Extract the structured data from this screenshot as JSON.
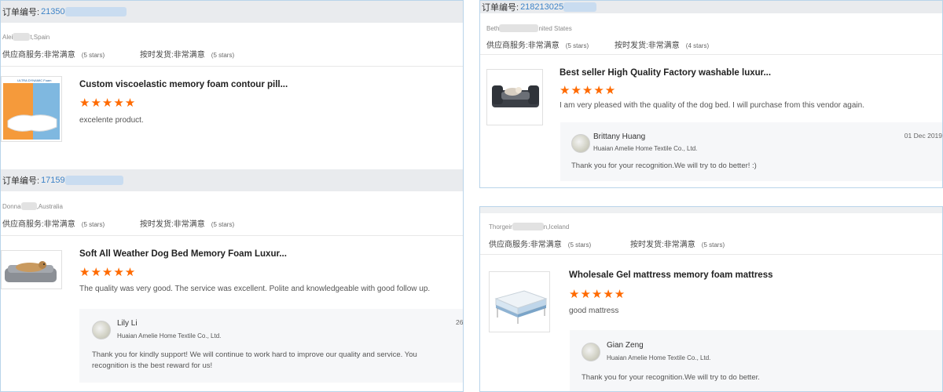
{
  "common": {
    "order_label": "订单编号:",
    "supplier_service_label": "供应商服务:",
    "delivery_label": "按时发货:",
    "very_satisfied": "非常满意",
    "five_stars": "(5 stars)",
    "four_stars": "(4 stars)",
    "seller_company": "Huaian Amelie Home Textile Co., Ltd.",
    "star_glyphs": "★★★★★"
  },
  "colors": {
    "accent": "#ff6a00",
    "link": "#3d83c7",
    "border": "#b9d4ea"
  },
  "reviews": [
    {
      "order_number": "21350",
      "buyer_name": "Alei",
      "buyer_location": "t,Spain",
      "product_title": "Custom viscoelastic memory foam contour pill...",
      "product_icon": "pillow-image",
      "rating": 5,
      "text": "excelente product."
    },
    {
      "order_number": "17159",
      "buyer_name": "Donna",
      "buyer_location": ",Australia",
      "product_title": "Soft All Weather Dog Bed Memory Foam Luxur...",
      "product_icon": "dog-bed-image",
      "rating": 5,
      "text": "The quality was very good. The service was excellent. Polite and knowledgeable with good follow up.",
      "reply": {
        "name": "Lily Li",
        "date": "26",
        "text_line1": "Thank you for kindly support! We will continue to work hard to improve our quality and service. You",
        "text_line2": "recognition is the best reward for us!"
      }
    },
    {
      "order_number": "218213025",
      "buyer_name": "Beth",
      "buyer_location": "nited States",
      "product_title": "Best seller High Quality Factory washable luxur...",
      "product_icon": "pet-sofa-image",
      "rating": 5,
      "text": "I am very pleased with the quality of the dog bed.  I will purchase from this vendor again.",
      "reply": {
        "name": "Brittany Huang",
        "date": "01 Dec 2019",
        "text_line1": "Thank you for your recognition.We will try to do better! :)"
      }
    },
    {
      "buyer_name": "Thorgeir",
      "buyer_location": "n,Iceland",
      "product_title": "Wholesale Gel mattress memory foam mattress",
      "product_icon": "mattress-image",
      "rating": 5,
      "text": "good mattress",
      "reply": {
        "name": "Gian Zeng",
        "text_line1": "Thank you for your recognition.We will try to do better."
      }
    }
  ]
}
